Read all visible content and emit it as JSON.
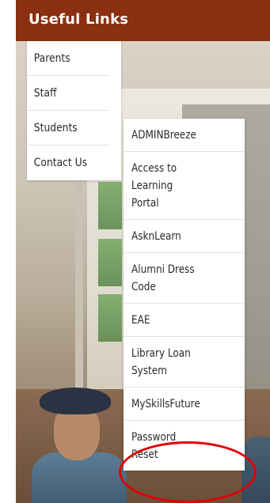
{
  "header": {
    "title": "Useful Links"
  },
  "menu": {
    "items": [
      {
        "label": "Parents"
      },
      {
        "label": "Staff"
      },
      {
        "label": "Students"
      },
      {
        "label": "Contact Us"
      }
    ]
  },
  "submenu": {
    "parent": "Students",
    "items": [
      {
        "label": "ADMINBreeze"
      },
      {
        "label": "Access to Learning Portal"
      },
      {
        "label": "AsknLearn"
      },
      {
        "label": "Alumni Dress Code"
      },
      {
        "label": "EAE"
      },
      {
        "label": "Library Loan System"
      },
      {
        "label": "MySkillsFuture"
      },
      {
        "label": "Password Reset"
      }
    ]
  },
  "colors": {
    "header_bg": "#8a2f10",
    "highlight": "#e00000"
  }
}
